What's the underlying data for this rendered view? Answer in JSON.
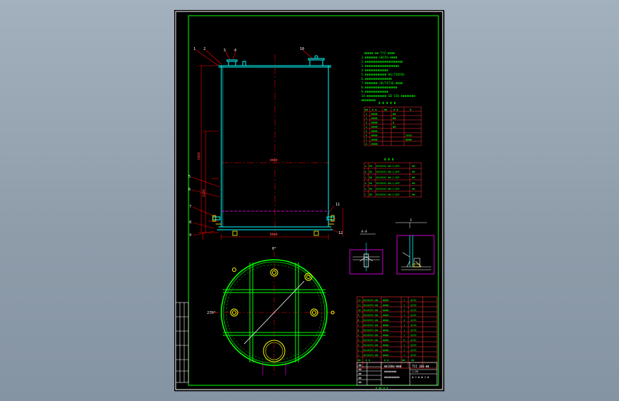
{
  "drawing": {
    "part_numbers": [
      "1",
      "2",
      "3",
      "4",
      "5",
      "6",
      "7",
      "8",
      "9",
      "10",
      "11",
      "12"
    ],
    "dimensions": {
      "overall_height": "8900",
      "upper_height": "4200",
      "centerline": "ΦΦΦΦ",
      "base_width": "ΦΦΦΦ"
    },
    "section_labels": [
      "A-A",
      "I",
      "II"
    ],
    "plan_labels": {
      "left": "270°",
      "top": "0°"
    }
  },
  "notes": {
    "title": "ΦΦΦΦΦ  ΦΦ TYZ-ΦΦΦΦ",
    "lines": [
      "1.ΦΦΦΦΦΦΦ GB150-ΦΦΦΦ",
      "2.ΦΦΦΦΦΦΦΦΦΦΦΦΦΦΦΦΦΦΦΦΦ",
      "3.ΦΦΦΦΦΦΦΦΦΦΦΦΦΦΦΦΦΦΦ",
      "4.ΦΦΦΦΦΦΦΦΦΦΦΦΦ",
      "5.ΦΦΦΦΦΦΦΦΦΦΦΦ HG/T20592",
      "6.ΦΦΦΦΦΦΦΦΦΦΦΦΦΦΦ",
      "7.ΦΦΦΦΦΦΦ JB/T4736-ΦΦΦΦ",
      "8.ΦΦΦΦΦΦΦΦΦΦΦΦΦΦΦΦΦΦ",
      "9.ΦΦΦΦΦΦΦΦΦΦΦΦΦ",
      "10.ΦΦΦΦΦΦΦΦΦΦΦ GB 150 ΦΦΦΦΦΦΦΦ",
      "   ΦΦΦΦΦΦΦΦ"
    ]
  },
  "design_table": {
    "title": "Φ Φ Φ Φ Φ",
    "headers": [
      "ΦΦ",
      "Φ Φ",
      "ΦΦ",
      "Φ Φ",
      "Φ"
    ],
    "rows": [
      [
        "1",
        "ΦΦΦΦ",
        "",
        "ΦΦ",
        ""
      ],
      [
        "2",
        "ΦΦΦΦ",
        "",
        "ΦΦ",
        ""
      ],
      [
        "3",
        "ΦΦΦΦ",
        "",
        "Φ",
        ""
      ],
      [
        "4",
        "ΦΦΦΦ",
        "",
        "ΦΦ",
        ""
      ],
      [
        "5",
        "ΦΦΦΦ",
        "",
        "",
        ""
      ],
      [
        "6",
        "ΦΦΦΦ",
        "",
        "",
        "2000"
      ],
      [
        "7",
        "ΦΦΦΦ",
        "",
        "",
        "ΦΦΦΦ"
      ],
      [
        "8",
        "ΦΦΦΦ",
        "",
        "",
        ""
      ]
    ]
  },
  "nozzle_table": {
    "title": "Φ Φ Φ",
    "rows": [
      [
        "a",
        "DN",
        "HG20592 ΦΦ-1.6RF",
        "ΦΦ"
      ],
      [
        "b",
        "DN",
        "HG20592 ΦΦ-1.6RF",
        "ΦΦ"
      ],
      [
        "c",
        "DN",
        "HG20592 ΦΦ-1.6RF",
        "ΦΦ"
      ],
      [
        "d",
        "DN",
        "HG20592 ΦΦ-1.6RF",
        "ΦΦ"
      ],
      [
        "e",
        "DN",
        "HG20592 ΦΦ-1.6RF",
        "ΦΦ"
      ],
      [
        "f",
        "DN",
        "HG20592 ΦΦ-1.6RF",
        "ΦΦ"
      ]
    ]
  },
  "bom": {
    "rows": [
      [
        "12",
        "HG20592-ΦΦ",
        "ΦΦΦΦ",
        "1",
        "Q235"
      ],
      [
        "11",
        "HG20592-ΦΦ",
        "ΦΦΦΦ",
        "1",
        "Q235"
      ],
      [
        "10",
        "HG20592-ΦΦ",
        "ΦΦΦΦ",
        "2",
        "Q235"
      ],
      [
        "9",
        "HG20592-ΦΦ",
        "ΦΦΦΦ",
        "1",
        "Q235"
      ],
      [
        "8",
        "HG20592-ΦΦ",
        "ΦΦΦΦ",
        "4",
        "Q235"
      ],
      [
        "7",
        "HG20592-ΦΦ",
        "ΦΦΦΦ",
        "1",
        "Q235"
      ],
      [
        "6",
        "HG20592-ΦΦ",
        "ΦΦΦΦ",
        "1",
        "Q235"
      ],
      [
        "5",
        "HG20592-ΦΦ",
        "ΦΦΦΦ",
        "1",
        "Q235"
      ],
      [
        "4",
        "HG20592-ΦΦ",
        "ΦΦΦΦ",
        "8",
        "Q235"
      ],
      [
        "3",
        "HG20592-ΦΦ",
        "ΦΦΦΦ",
        "1",
        "Q235"
      ],
      [
        "2",
        "HG20592-ΦΦ",
        "ΦΦΦΦ",
        "1",
        "Q235"
      ],
      [
        "1",
        "HG20592-ΦΦ",
        "ΦΦΦΦ",
        "1",
        "Q235"
      ]
    ],
    "header": [
      "ΦΦ",
      "Φ Φ",
      "Φ Φ",
      "ΦΦ",
      "ΦΦ"
    ]
  },
  "title_block": {
    "name": "ΦΦ100m³ΦΦΦ",
    "drawing_no": "TYZ 100-ΦΦ",
    "sub": "ΦΦΦΦΦΦΦΦ",
    "company": "ΦΦΦΦΦΦΦΦΦΦ",
    "scale": "1:20",
    "sheet": "Φ 1 Φ  Φ 1 Φ",
    "sign_rows": [
      "ΦΦ",
      "ΦΦ",
      "ΦΦ",
      "ΦΦ",
      "ΦΦ"
    ],
    "footer": "Φ  ΦΦ  Φ Φ"
  },
  "colors": {
    "border": "#ffffff",
    "frame": "#00ff00",
    "vessel": "#00ffff",
    "dimension": "#ff0000",
    "hidden": "#ff00ff",
    "text_green": "#00ff00",
    "table_red": "#ff3030",
    "nozzle": "#ffff00"
  }
}
